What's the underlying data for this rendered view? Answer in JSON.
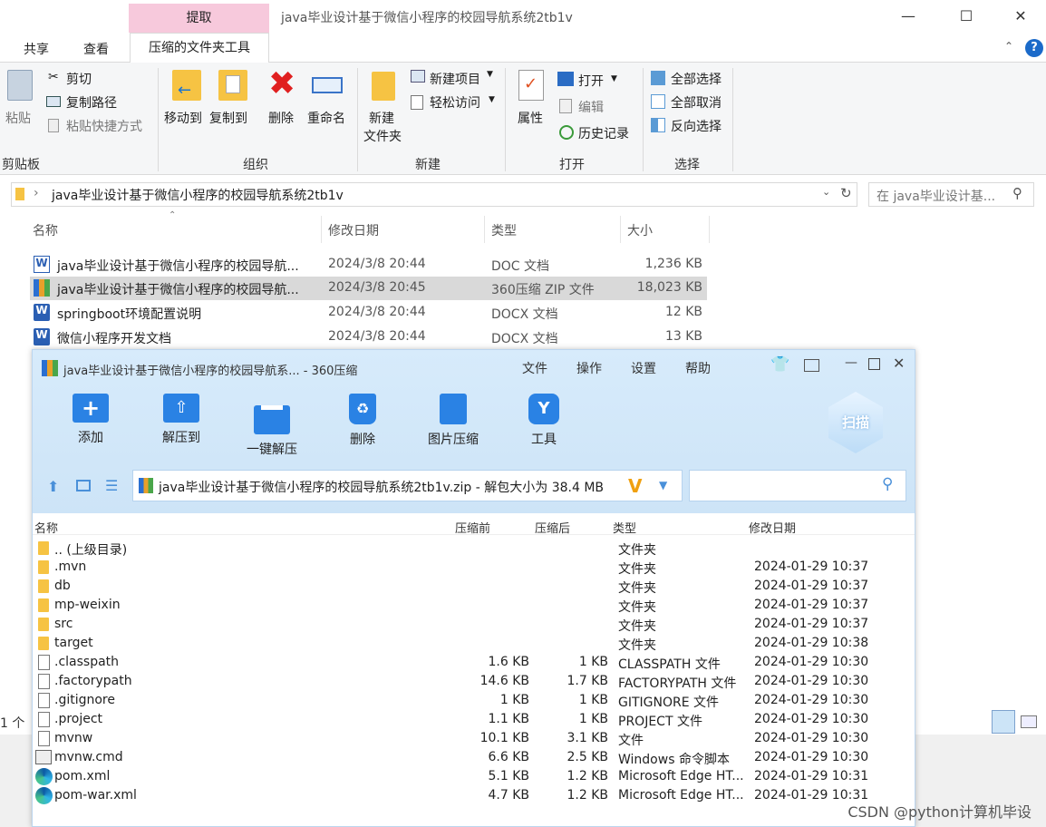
{
  "explorer": {
    "context_tab": "提取",
    "window_title": "java毕业设计基于微信小程序的校园导航系统2tb1v",
    "tabs": [
      "共享",
      "查看",
      "压缩的文件夹工具"
    ],
    "ribbon": {
      "clipboard": {
        "paste": "粘贴",
        "cut": "剪切",
        "copy_path": "复制路径",
        "paste_shortcut": "粘贴快捷方式",
        "group": "剪贴板"
      },
      "organize": {
        "move_to": "移动到",
        "copy_to": "复制到",
        "delete": "删除",
        "rename": "重命名",
        "group": "组织"
      },
      "new": {
        "new_folder_1": "新建",
        "new_folder_2": "文件夹",
        "new_item": "新建项目",
        "easy_access": "轻松访问",
        "group": "新建"
      },
      "open": {
        "properties": "属性",
        "open": "打开",
        "edit": "编辑",
        "history": "历史记录",
        "group": "打开"
      },
      "select": {
        "select_all": "全部选择",
        "select_none": "全部取消",
        "invert": "反向选择",
        "group": "选择"
      }
    },
    "address": "java毕业设计基于微信小程序的校园导航系统2tb1v",
    "search_placeholder": "在 java毕业设计基...",
    "columns": {
      "name": "名称",
      "date": "修改日期",
      "type": "类型",
      "size": "大小"
    },
    "files": [
      {
        "name": "java毕业设计基于微信小程序的校园导航...",
        "date": "2024/3/8 20:44",
        "type": "DOC 文档",
        "size": "1,236 KB",
        "icon": "word-doc-icon"
      },
      {
        "name": "java毕业设计基于微信小程序的校园导航...",
        "date": "2024/3/8 20:45",
        "type": "360压缩 ZIP 文件",
        "size": "18,023 KB",
        "icon": "zip-archive-icon"
      },
      {
        "name": "springboot环境配置说明",
        "date": "2024/3/8 20:44",
        "type": "DOCX 文档",
        "size": "12 KB",
        "icon": "word-icon"
      },
      {
        "name": "微信小程序开发文档",
        "date": "2024/3/8 20:44",
        "type": "DOCX 文档",
        "size": "13 KB",
        "icon": "word-icon"
      }
    ],
    "status_count": "1 个"
  },
  "zip_window": {
    "title": "java毕业设计基于微信小程序的校园导航系... - 360压缩",
    "menu": [
      "文件",
      "操作",
      "设置",
      "帮助"
    ],
    "tools": [
      "添加",
      "解压到",
      "一键解压",
      "删除",
      "图片压缩",
      "工具"
    ],
    "scan_label": "扫描",
    "path": "java毕业设计基于微信小程序的校园导航系统2tb1v.zip - 解包大小为 38.4 MB",
    "columns": {
      "name": "名称",
      "before": "压缩前",
      "after": "压缩后",
      "type": "类型",
      "date": "修改日期"
    },
    "entries": [
      {
        "name": ".. (上级目录)",
        "before": "",
        "after": "",
        "type": "文件夹",
        "date": "",
        "icon": "folder"
      },
      {
        "name": ".mvn",
        "before": "",
        "after": "",
        "type": "文件夹",
        "date": "2024-01-29 10:37",
        "icon": "folder"
      },
      {
        "name": "db",
        "before": "",
        "after": "",
        "type": "文件夹",
        "date": "2024-01-29 10:37",
        "icon": "folder"
      },
      {
        "name": "mp-weixin",
        "before": "",
        "after": "",
        "type": "文件夹",
        "date": "2024-01-29 10:37",
        "icon": "folder"
      },
      {
        "name": "src",
        "before": "",
        "after": "",
        "type": "文件夹",
        "date": "2024-01-29 10:37",
        "icon": "folder"
      },
      {
        "name": "target",
        "before": "",
        "after": "",
        "type": "文件夹",
        "date": "2024-01-29 10:38",
        "icon": "folder"
      },
      {
        "name": ".classpath",
        "before": "1.6 KB",
        "after": "1 KB",
        "type": "CLASSPATH 文件",
        "date": "2024-01-29 10:30",
        "icon": "doc"
      },
      {
        "name": ".factorypath",
        "before": "14.6 KB",
        "after": "1.7 KB",
        "type": "FACTORYPATH 文件",
        "date": "2024-01-29 10:30",
        "icon": "doc"
      },
      {
        "name": ".gitignore",
        "before": "1 KB",
        "after": "1 KB",
        "type": "GITIGNORE 文件",
        "date": "2024-01-29 10:30",
        "icon": "doc"
      },
      {
        "name": ".project",
        "before": "1.1 KB",
        "after": "1 KB",
        "type": "PROJECT 文件",
        "date": "2024-01-29 10:30",
        "icon": "doc"
      },
      {
        "name": "mvnw",
        "before": "10.1 KB",
        "after": "3.1 KB",
        "type": "文件",
        "date": "2024-01-29 10:30",
        "icon": "doc"
      },
      {
        "name": "mvnw.cmd",
        "before": "6.6 KB",
        "after": "2.5 KB",
        "type": "Windows 命令脚本",
        "date": "2024-01-29 10:30",
        "icon": "cmd"
      },
      {
        "name": "pom.xml",
        "before": "5.1 KB",
        "after": "1.2 KB",
        "type": "Microsoft Edge HT...",
        "date": "2024-01-29 10:31",
        "icon": "edge"
      },
      {
        "name": "pom-war.xml",
        "before": "4.7 KB",
        "after": "1.2 KB",
        "type": "Microsoft Edge HT...",
        "date": "2024-01-29 10:31",
        "icon": "edge"
      }
    ]
  },
  "watermark": "CSDN @python计算机毕设"
}
